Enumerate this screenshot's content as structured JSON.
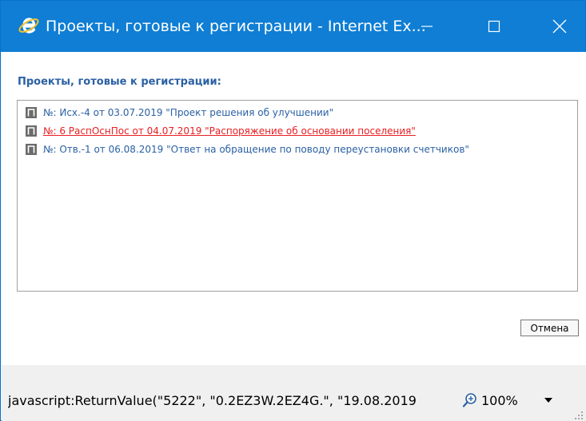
{
  "window": {
    "title": "Проекты, готовые к регистрации - Internet Ex...",
    "accent_color": "#0f7ed4"
  },
  "page": {
    "heading": "Проекты, готовые к регистрации:",
    "heading_color": "#2b61a4"
  },
  "list": {
    "mark_glyph": "П",
    "items": [
      {
        "label": "№: Исх.-4 от 03.07.2019 \"Проект решения об улучшении\""
      },
      {
        "label": "№: 6 РаспОснПос от 04.07.2019 \"Распоряжение об основании поселения\"",
        "state": "active"
      },
      {
        "label": "№: Отв.-1 от 06.08.2019 \"Ответ на обращение по поводу переустановки счетчиков\""
      }
    ]
  },
  "buttons": {
    "cancel_label": "Отмена"
  },
  "statusbar": {
    "text": "javascript:ReturnValue(\"5222\", \"0.2EZ3W.2EZ4G.\", \"19.08.2019",
    "zoom": "100%"
  },
  "icons": {
    "logo": "internet-explorer-icon",
    "minimize": "minimize-icon",
    "maximize": "maximize-icon",
    "close": "close-icon",
    "zoom": "zoom-in-icon",
    "dropdown": "chevron-down-icon",
    "resize": "resize-grip-icon"
  }
}
